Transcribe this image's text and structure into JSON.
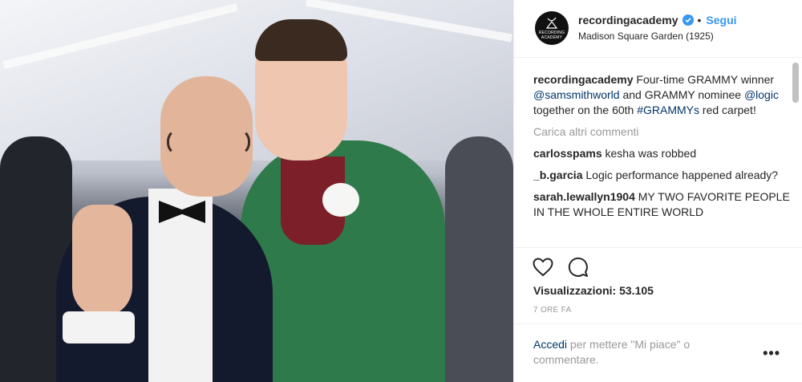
{
  "account": {
    "username": "recordingacademy",
    "follow_label": "Segui",
    "separator": "•",
    "location": "Madison Square Garden (1925)",
    "avatar_logo_text": "RECORDING ACADEMY"
  },
  "caption": {
    "username": "recordingacademy",
    "part1": "Four-time GRAMMY winner",
    "mention1": "@samsmithworld",
    "part2": "and GRAMMY nominee",
    "mention2": "@logic",
    "part3": "together on the 60th",
    "hashtag": "#GRAMMYs",
    "part4": "red carpet!"
  },
  "load_more_label": "Carica altri commenti",
  "comments": [
    {
      "user": "carlosspams",
      "text": "kesha was robbed"
    },
    {
      "user": "_b.garcia",
      "text": "Logic performance happened already?"
    },
    {
      "user": "sarah.lewallyn1904",
      "text": "MY TWO FAVORITE PEOPLE IN THE WHOLE ENTIRE WORLD"
    }
  ],
  "stats": {
    "views_label": "Visualizzazioni:",
    "views_count": "53.105",
    "time_ago": "7 ORE FA"
  },
  "login": {
    "link": "Accedi",
    "rest": "per mettere \"Mi piace\" o commentare."
  },
  "icons": {
    "like": "heart-icon",
    "comment": "comment-icon",
    "more": "more-options-icon",
    "verified": "verified-badge-icon"
  },
  "colors": {
    "link": "#003569",
    "follow": "#3897f0",
    "muted": "#999999",
    "text": "#262626"
  }
}
